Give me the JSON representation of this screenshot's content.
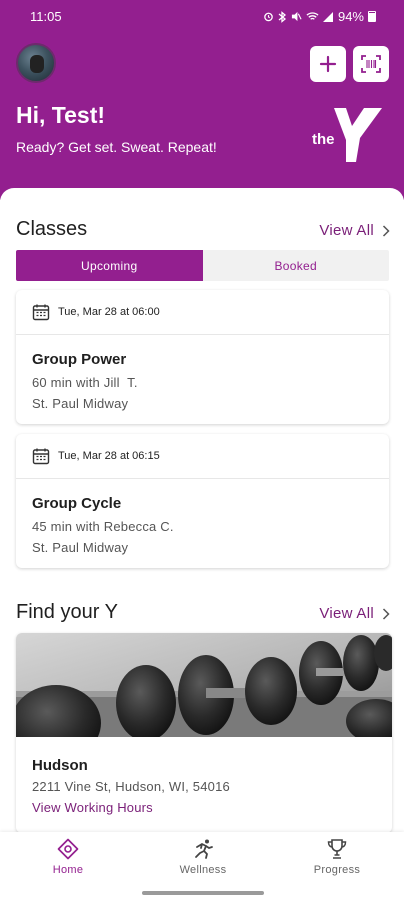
{
  "status": {
    "time": "11:05",
    "battery": "94%"
  },
  "header": {
    "greeting": "Hi, Test!",
    "tagline": "Ready? Get set. Sweat. Repeat!",
    "brand_small": "the",
    "accent_color": "#931f8f"
  },
  "classes": {
    "title": "Classes",
    "view_all": "View All",
    "tabs": [
      {
        "label": "Upcoming",
        "active": true
      },
      {
        "label": "Booked",
        "active": false
      }
    ],
    "items": [
      {
        "date": "Tue, Mar 28 at 06:00",
        "name": "Group Power",
        "detail": "60 min with Jill  T.",
        "location": "St. Paul Midway"
      },
      {
        "date": "Tue, Mar 28 at 06:15",
        "name": "Group Cycle",
        "detail": "45 min with Rebecca C.",
        "location": "St. Paul Midway"
      }
    ]
  },
  "find_y": {
    "title": "Find your Y",
    "view_all": "View All",
    "location": {
      "name": "Hudson",
      "address": "2211 Vine St, Hudson, WI, 54016",
      "hours_link": "View Working Hours"
    }
  },
  "nav": {
    "items": [
      {
        "label": "Home",
        "icon": "home-icon",
        "active": true
      },
      {
        "label": "Wellness",
        "icon": "runner-icon",
        "active": false
      },
      {
        "label": "Progress",
        "icon": "trophy-icon",
        "active": false
      }
    ]
  }
}
